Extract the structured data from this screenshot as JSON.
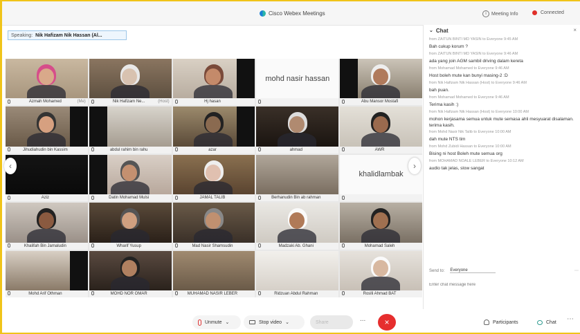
{
  "window": {
    "title": "Cisco Webex Meetings",
    "meeting_info": "Meeting Info",
    "status": "Connected"
  },
  "speaking": {
    "label": "Speaking:",
    "name": "Nik Hafizam Nik Hassan (Al..."
  },
  "participants": [
    {
      "name": "Azmah Mohamed",
      "extra": "(Me)",
      "video": "woman-pink"
    },
    {
      "name": "Nik Hafizam Ne...",
      "extra": "(Host)",
      "video": "man-white-hair",
      "active": true
    },
    {
      "name": "Hj hasan",
      "video": "man-red"
    },
    {
      "name": "",
      "video": "text",
      "display_text": "mohd nasir hassan"
    },
    {
      "name": "Abu Mansor Mostafi",
      "video": "man-cap"
    },
    {
      "name": "Jihudiahudin bin Kassim",
      "video": "man-glasses"
    },
    {
      "name": "abdul rahim bin rahu",
      "video": "room"
    },
    {
      "name": "azar",
      "video": "room-dark"
    },
    {
      "name": "ahmad",
      "video": "man-dark"
    },
    {
      "name": "AWR",
      "video": "man-light"
    },
    {
      "name": "Aziz",
      "video": "dark"
    },
    {
      "name": "Datin Mohamad Mulsi",
      "video": "man-glasses-red"
    },
    {
      "name": "JAMAL TALIB",
      "video": "man-shelf"
    },
    {
      "name": "Berhanudin Bin ab rahman",
      "video": "wall-picture"
    },
    {
      "name": "",
      "video": "text",
      "display_text": "khalidlambak"
    },
    {
      "name": "Khalifah Bin Jamaludin",
      "video": "man-black"
    },
    {
      "name": "Wharif Yusup",
      "video": "man-orange"
    },
    {
      "name": "Mad Nasir Shamsudin",
      "video": "man-shelf2"
    },
    {
      "name": "Madzaki Ab. Ghani",
      "video": "man-white-cap"
    },
    {
      "name": "Mohamad Saleh",
      "video": "man-room"
    },
    {
      "name": "Mohd Arif Othman",
      "video": "shelf"
    },
    {
      "name": "MOHD NOR OMAR",
      "video": "man-dark2"
    },
    {
      "name": "MUHAMAD NASIR LEBER",
      "video": "kitchen"
    },
    {
      "name": "Ridzuan Abdul Rahman",
      "video": "ceiling"
    },
    {
      "name": "Roslli Ahmad BAT",
      "video": "woman-white"
    }
  ],
  "chat": {
    "title": "Chat",
    "messages": [
      {
        "from": "from ZAITUN BINTI MD YASIN to Everyone    9:45 AM",
        "text": "Bah cukup korum ?"
      },
      {
        "from": "from ZAITUN BINTI MD YASIN to Everyone    9:46 AM",
        "text": "ada yang join AGM sambil driving dalam kereta"
      },
      {
        "from": "from Mohamad Mohamed to Everyone    9:46 AM",
        "text": "Host boleh mute kan bunyi masing-2 :D"
      },
      {
        "from": "from Nik Hafizam Nik Hassan (Host) to Everyone    9:46 AM",
        "text": "bah puan."
      },
      {
        "from": "from Mohamad Mohamed to Everyone    9:46 AM",
        "text": "Terima kasih :)"
      },
      {
        "from": "from Nik Hafizam Nik Hassan (Host) to Everyone    10:00 AM",
        "text": "mohon kerjasama semua untuk mute semasa ahli mesyuarat disalaman. terima kasih."
      },
      {
        "from": "from Mohd Nasir Nik Talib to Everyone    10:00 AM",
        "text": "dah mute NTS tim"
      },
      {
        "from": "from Mohd Zubidi Hassan to Everyone    10:00 AM",
        "text": "Bising ni host Boleh mute semua org"
      },
      {
        "from": "from MOHAMAD NOALE LEBER to Everyone    10:12 AM",
        "text": "audio tak jelas, slow sangat"
      }
    ],
    "to_label": "Send to:",
    "to_value": "Everyone",
    "input_placeholder": "Enter chat message here"
  },
  "controls": {
    "mute": "Unmute",
    "video": "Stop video",
    "share": "Share",
    "more": "...",
    "participants": "Participants",
    "chat": "Chat"
  }
}
